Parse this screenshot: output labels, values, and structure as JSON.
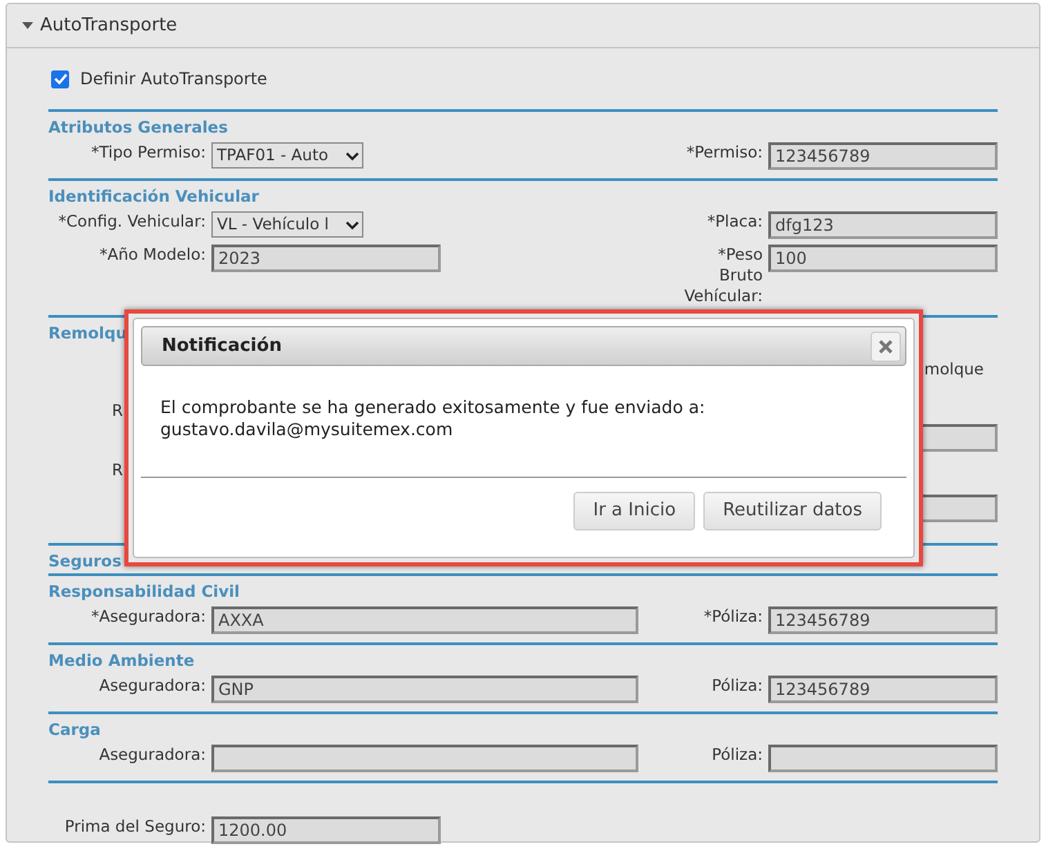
{
  "panel": {
    "title": "AutoTransporte",
    "expanded": true
  },
  "define": {
    "label": "Definir AutoTransporte",
    "checked": true
  },
  "sections": [
    {
      "kind": "fields",
      "title": "Atributos Generales",
      "rows": [
        {
          "left": {
            "label": "*Tipo Permiso:",
            "kind": "select",
            "value": "TPAF01 - Auto"
          },
          "right": {
            "label": "*Permiso:",
            "kind": "text",
            "value": "123456789"
          }
        }
      ]
    },
    {
      "kind": "fields",
      "title": "Identificación Vehicular",
      "rows": [
        {
          "left": {
            "label": "*Config. Vehicular:",
            "kind": "select",
            "value": "VL - Vehículo l"
          },
          "right": {
            "label": "*Placa:",
            "kind": "text",
            "value": "dfg123"
          }
        },
        {
          "left": {
            "label": "*Año Modelo:",
            "kind": "text",
            "value": "2023"
          },
          "right": {
            "label": "*Peso Bruto Vehícular:",
            "kind": "text",
            "value": "100"
          }
        }
      ]
    },
    {
      "kind": "covered",
      "title": "Remolqu",
      "side_text": "molque",
      "labels": [
        "R",
        "R"
      ]
    },
    {
      "kind": "heading",
      "title": "Seguros"
    },
    {
      "kind": "fields",
      "title": "Responsabilidad Civil",
      "rows": [
        {
          "left": {
            "label": "*Aseguradora:",
            "kind": "wide",
            "value": "AXXA"
          },
          "right": {
            "label": "*Póliza:",
            "kind": "text",
            "value": "123456789"
          }
        }
      ]
    },
    {
      "kind": "fields",
      "title": "Medio Ambiente",
      "rows": [
        {
          "left": {
            "label": "Aseguradora:",
            "kind": "wide",
            "value": "GNP"
          },
          "right": {
            "label": "Póliza:",
            "kind": "text",
            "value": "123456789"
          }
        }
      ]
    },
    {
      "kind": "fields",
      "title": "Carga",
      "rows": [
        {
          "left": {
            "label": "Aseguradora:",
            "kind": "wide"
          },
          "right": {
            "label": "Póliza:",
            "kind": "text"
          }
        }
      ]
    }
  ],
  "premium": {
    "label": "Prima del Seguro:",
    "kind": "text",
    "value": "1200.00"
  },
  "dialog": {
    "title": "Notificación",
    "message": "El comprobante se ha generado exitosamente y fue enviado a: gustavo.davila@mysuitemex.com",
    "buttons": [
      "Ir a Inicio",
      "Reutilizar datos"
    ]
  }
}
